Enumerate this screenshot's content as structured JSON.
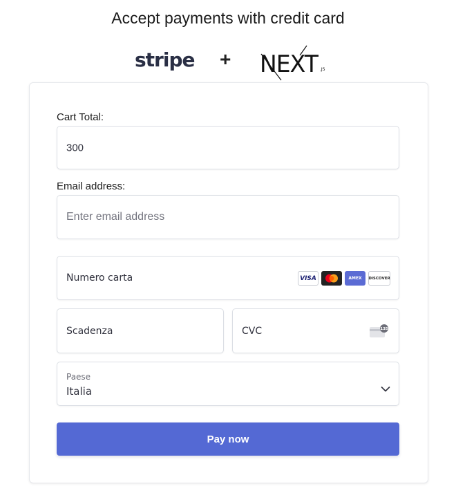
{
  "header": {
    "title": "Accept payments with credit card",
    "logos": {
      "stripe": "stripe",
      "plus": "+",
      "next": "NEXT",
      "next_suffix": ".JS"
    }
  },
  "form": {
    "cart_total": {
      "label": "Cart Total:",
      "value": "300"
    },
    "email": {
      "label": "Email address:",
      "placeholder": "Enter email address"
    },
    "payment": {
      "card_number_placeholder": "Numero carta",
      "card_brands": [
        "visa-icon",
        "mastercard-icon",
        "amex-icon",
        "discover-icon"
      ],
      "visa_text": "VISA",
      "amex_text": "AMEX",
      "discover_text": "DISCOVER",
      "expiry_placeholder": "Scadenza",
      "cvc_placeholder": "CVC",
      "cvc_badge": "135",
      "country_label": "Paese",
      "country_value": "Italia"
    },
    "submit_label": "Pay now"
  },
  "colors": {
    "button": "#5469d4",
    "border": "#dcdfe5",
    "text": "#1a1f36"
  }
}
